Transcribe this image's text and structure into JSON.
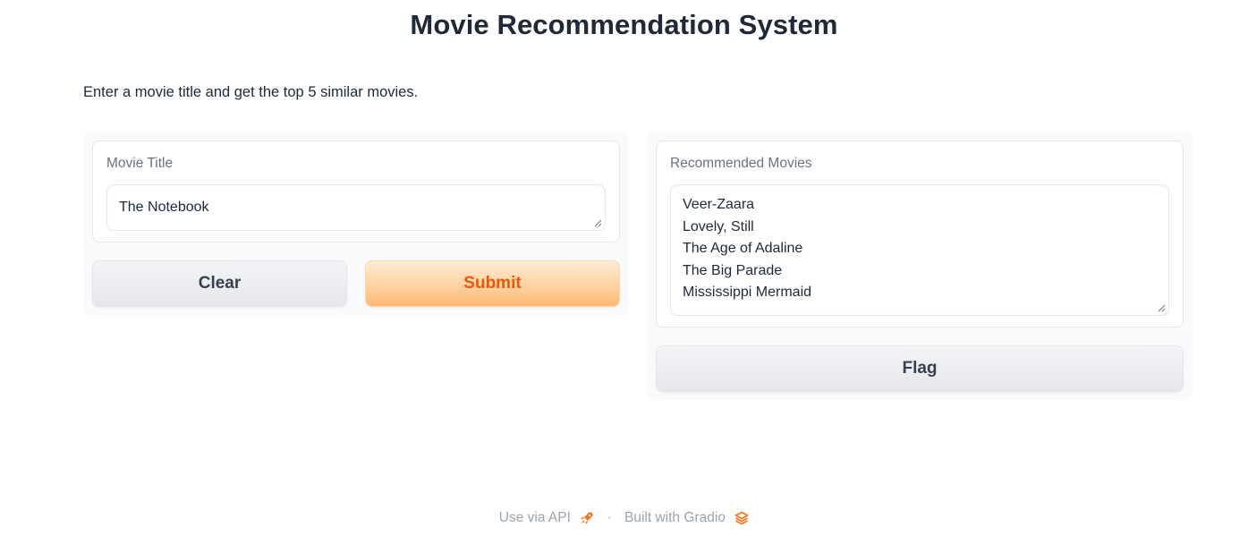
{
  "header": {
    "title": "Movie Recommendation System",
    "description": "Enter a movie title and get the top 5 similar movies."
  },
  "input": {
    "label": "Movie Title",
    "value": "The Notebook"
  },
  "buttons": {
    "clear": "Clear",
    "submit": "Submit",
    "flag": "Flag"
  },
  "output": {
    "label": "Recommended Movies",
    "movies": [
      "Veer-Zaara",
      "Lovely, Still",
      "The Age of Adaline",
      "The Big Parade",
      "Mississippi Mermaid"
    ]
  },
  "footer": {
    "api_link": "Use via API",
    "api_icon": "rocket-icon",
    "separator": "·",
    "built_with": "Built with Gradio",
    "gradio_icon": "gradio-logo-icon"
  },
  "colors": {
    "primary_text": "#ea580c",
    "primary_bg_top": "#ffedd5",
    "primary_bg_bottom": "#fdba74",
    "muted": "#9ca3af"
  }
}
